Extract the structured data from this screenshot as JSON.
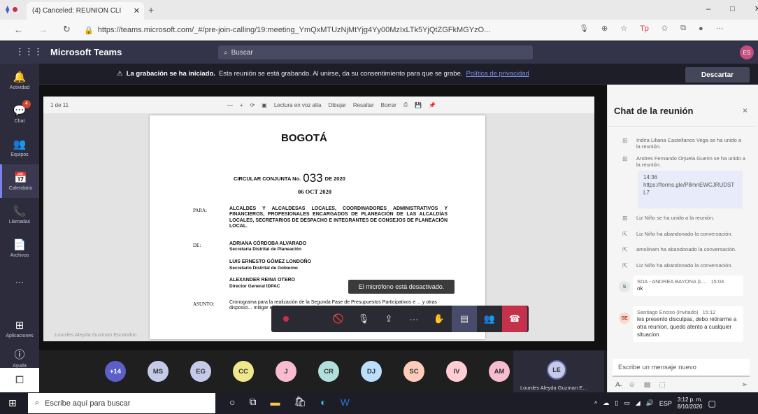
{
  "browser": {
    "tab_title": "(4) Canceled: REUNION CLI",
    "new_tab": "+",
    "url": "https://teams.microsoft.com/_#/pre-join-calling/19:meeting_YmQxMTUzNjMtYjg4Yy00MzIxLTk5YjQtZGFkMGYzO...",
    "window_controls": [
      "–",
      "□",
      "✕"
    ]
  },
  "teams": {
    "app_title": "Microsoft Teams",
    "search_placeholder": "Buscar",
    "user_initials": "ES",
    "rail": [
      {
        "icon": "bell-icon",
        "label": "Actividad",
        "badge": ""
      },
      {
        "icon": "chat-icon",
        "label": "Chat",
        "badge": "4"
      },
      {
        "icon": "teams-icon",
        "label": "Equipos",
        "badge": ""
      },
      {
        "icon": "calendar-icon",
        "label": "Calendario",
        "badge": ""
      },
      {
        "icon": "phone-icon",
        "label": "Llamadas",
        "badge": ""
      },
      {
        "icon": "file-icon",
        "label": "Archivos",
        "badge": ""
      },
      {
        "icon": "more-icon",
        "label": "···",
        "badge": ""
      }
    ],
    "rail_bottom": [
      {
        "icon": "apps-icon",
        "label": "Aplicaciones"
      },
      {
        "icon": "help-icon",
        "label": "Ayuda"
      }
    ]
  },
  "banner": {
    "bold": "La grabación se ha iniciado.",
    "text": "Esta reunión se está grabando. Al unirse, da su consentimiento para que se grabe.",
    "link": "Política de privacidad",
    "discard": "Descartar"
  },
  "pdf": {
    "page_indicator": "1 de 11",
    "toolbar": [
      "—",
      "+",
      "Lectura en voz alta",
      "Dibujar",
      "Resaltar",
      "Borrar"
    ],
    "logo": "BOGOTÁ",
    "circular_prefix": "CIRCULAR CONJUNTA No.",
    "circular_number": "033",
    "circular_suffix": "DE 2020",
    "date": "06 OCT 2020",
    "para_label": "PARA:",
    "para_text": "ALCALDES Y ALCALDESAS LOCALES, COORDINADORES ADMINISTRATIVOS Y FINANCIEROS, PROFESIONALES ENCARGADOS DE PLANEACIÓN DE LAS ALCALDÍAS LOCALES, SECRETARIOS DE DESPACHO E INTEGRANTES DE CONSEJOS DE PLANEACIÓN LOCAL.",
    "de_label": "DE:",
    "de_1_name": "ADRIANA CÓRDOBA ALVARADO",
    "de_1_role": "Secretaria Distrital de Planeación",
    "de_2_name": "LUIS ERNESTO GÓMEZ LONDOÑO",
    "de_2_role": "Secretario Distrital de Gobierno",
    "de_3_name": "ALEXANDER REINA OTERO",
    "de_3_role": "Director General IDPAC",
    "asunto_label": "ASUNTO:",
    "asunto_text": "Cronograma para la realización de la Segunda Fase de Presupuestos Participativos e ... y otras disposici... mitigar el riesgo ... Coronavirus (CO...",
    "caption": "Lourdes Aleyda Guzman Escandon"
  },
  "tooltip": "El micrófono está desactivado.",
  "controls": {
    "icons": [
      "record-icon",
      "camera-off-icon",
      "mic-off-icon",
      "share-icon",
      "more-icon",
      "raise-hand-icon",
      "chat-icon",
      "participants-icon",
      "hangup-icon"
    ]
  },
  "chat": {
    "title": "Chat de la reunión",
    "close": "×",
    "messages": [
      {
        "type": "system",
        "text": "Indira Liliana Castellanos Vega se ha unido a la reunión."
      },
      {
        "type": "system",
        "text": "Andres Fernando Orjuela Guerin se ha unido a la reunión."
      },
      {
        "type": "link",
        "time": "14:36",
        "text": "https://forms.gle/P8mnEWCJRUDSTL7"
      },
      {
        "type": "system",
        "text": "Liz Niño se ha unido a la reunión."
      },
      {
        "type": "system",
        "text": "Liz Niño ha abandonado la conversación."
      },
      {
        "type": "system",
        "text": "amolinam ha abandonado la conversación."
      },
      {
        "type": "system",
        "text": "Liz Niño ha abandonado la conversación."
      },
      {
        "type": "message",
        "initials": "S",
        "author": "SDA - ANDREA BAYONA (L...",
        "time": "15:04",
        "text": "ok"
      },
      {
        "type": "message",
        "initials": "SE",
        "author": "Santiago Enciso (Invitado)",
        "time": "15:12",
        "text": "les presento disculpas, debo retirarme a otra reunion, quedo atento a cualquier situacion"
      }
    ],
    "compose_placeholder": "Escribe un mensaje nuevo"
  },
  "participants": [
    {
      "initials": "+14",
      "color": "#5b5fc7"
    },
    {
      "initials": "MS",
      "color": "#c5cae9"
    },
    {
      "initials": "EG",
      "color": "#c5cae9"
    },
    {
      "initials": "CC",
      "color": "#f0e68c"
    },
    {
      "initials": "J",
      "color": "#f8bbd0"
    },
    {
      "initials": "CR",
      "color": "#b2dfdb"
    },
    {
      "initials": "DJ",
      "color": "#bbdefb"
    },
    {
      "initials": "SC",
      "color": "#ffccbc"
    },
    {
      "initials": "IV",
      "color": "#ffcdd2"
    },
    {
      "initials": "AM",
      "color": "#f8bbd0"
    }
  ],
  "active_speaker": {
    "initials": "LE",
    "name": "Lourdes Aleyda Guzman E..."
  },
  "taskbar": {
    "search_placeholder": "Escribe aquí para buscar",
    "language": "ESP",
    "time": "3:12 p. m.",
    "date": "8/10/2020"
  }
}
